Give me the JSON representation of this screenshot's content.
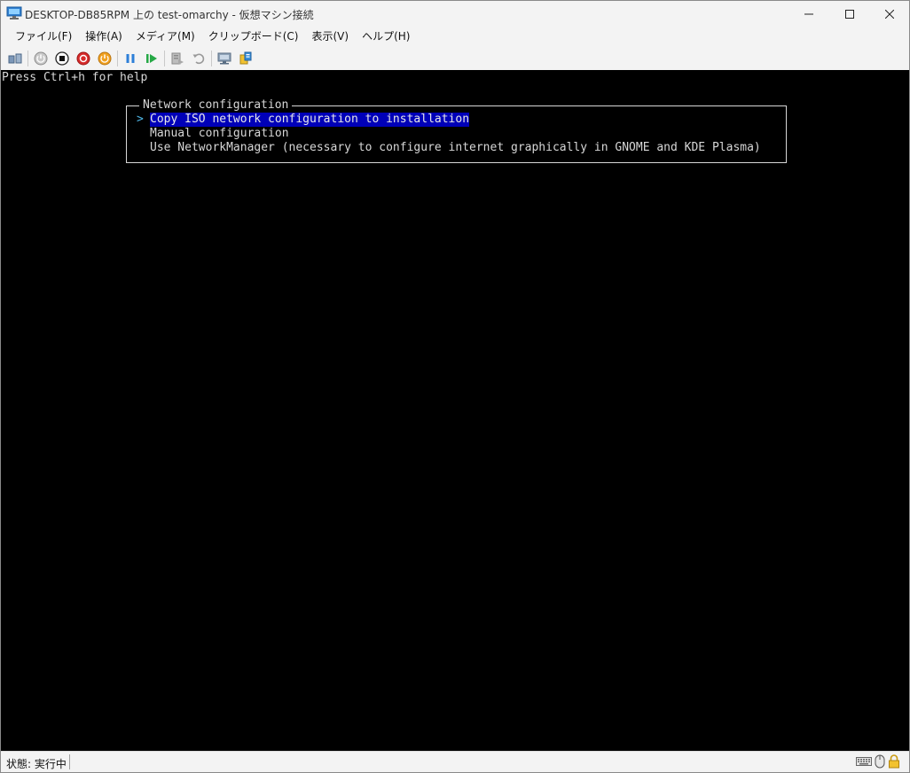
{
  "window": {
    "title": "DESKTOP-DB85RPM 上の test-omarchy - 仮想マシン接続"
  },
  "menu": {
    "items": [
      "ファイル(F)",
      "操作(A)",
      "メディア(M)",
      "クリップボード(C)",
      "表示(V)",
      "ヘルプ(H)"
    ]
  },
  "toolbar": {
    "icons": [
      "ctrl-alt-del-icon",
      "start-icon",
      "turn-off-icon",
      "shutdown-icon",
      "save-icon",
      "pause-icon",
      "resume-icon",
      "checkpoint-icon",
      "revert-icon",
      "enhanced-session-icon",
      "share-icon"
    ]
  },
  "console": {
    "help_line": "Press Ctrl+h for help",
    "dialog": {
      "title": "Network configuration",
      "selected_marker": ">",
      "options": [
        "Copy ISO network configuration to installation",
        "Manual configuration",
        "Use NetworkManager (necessary to configure internet graphically in GNOME and KDE Plasma)"
      ]
    }
  },
  "status": {
    "text": "状態: 実行中"
  },
  "colors": {
    "selection": "#0000b8",
    "marker": "#4fb8e8",
    "console_bg": "#000000"
  }
}
